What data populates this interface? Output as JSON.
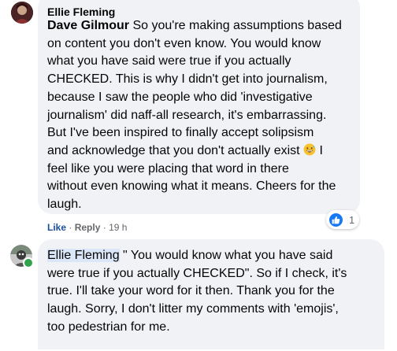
{
  "comment1": {
    "author": "Ellie Fleming",
    "tag": "Dave Gilmour",
    "lines": [
      " So you're making assumptions based",
      "on content you don't even know. You would know",
      "what you have said were true if you actually",
      "CHECKED. This is why I didn't get into journalism,",
      "because I saw the people who did 'investigative",
      "journalism' did naff-all research, it's embarrassing.",
      "But I've been inspired to finally accept solipsism",
      "and acknowledge that you don't actually exist ",
      " I",
      "feel like you were placing that word in there",
      "without even knowing what it means. Cheers for the",
      "laugh."
    ],
    "emoji": "grinning-sweat-emoji",
    "like_label": "Like",
    "separator": "·",
    "reply_label": "Reply",
    "time": "19 h",
    "reaction_count": "1",
    "reaction_icon": "thumbs-up-icon",
    "reaction_color": "#1877f2"
  },
  "comment2": {
    "mention": "Ellie Fleming",
    "lines": [
      " \" You would know what you have said",
      "were true if you actually CHECKED\". So if I check, it's",
      "true. I'll take your word for it then. Thank you for the",
      "laugh. Sorry, I don't litter my comments with 'emojis',",
      "too pedestrian for me."
    ],
    "online_status_color": "#31a24c"
  }
}
